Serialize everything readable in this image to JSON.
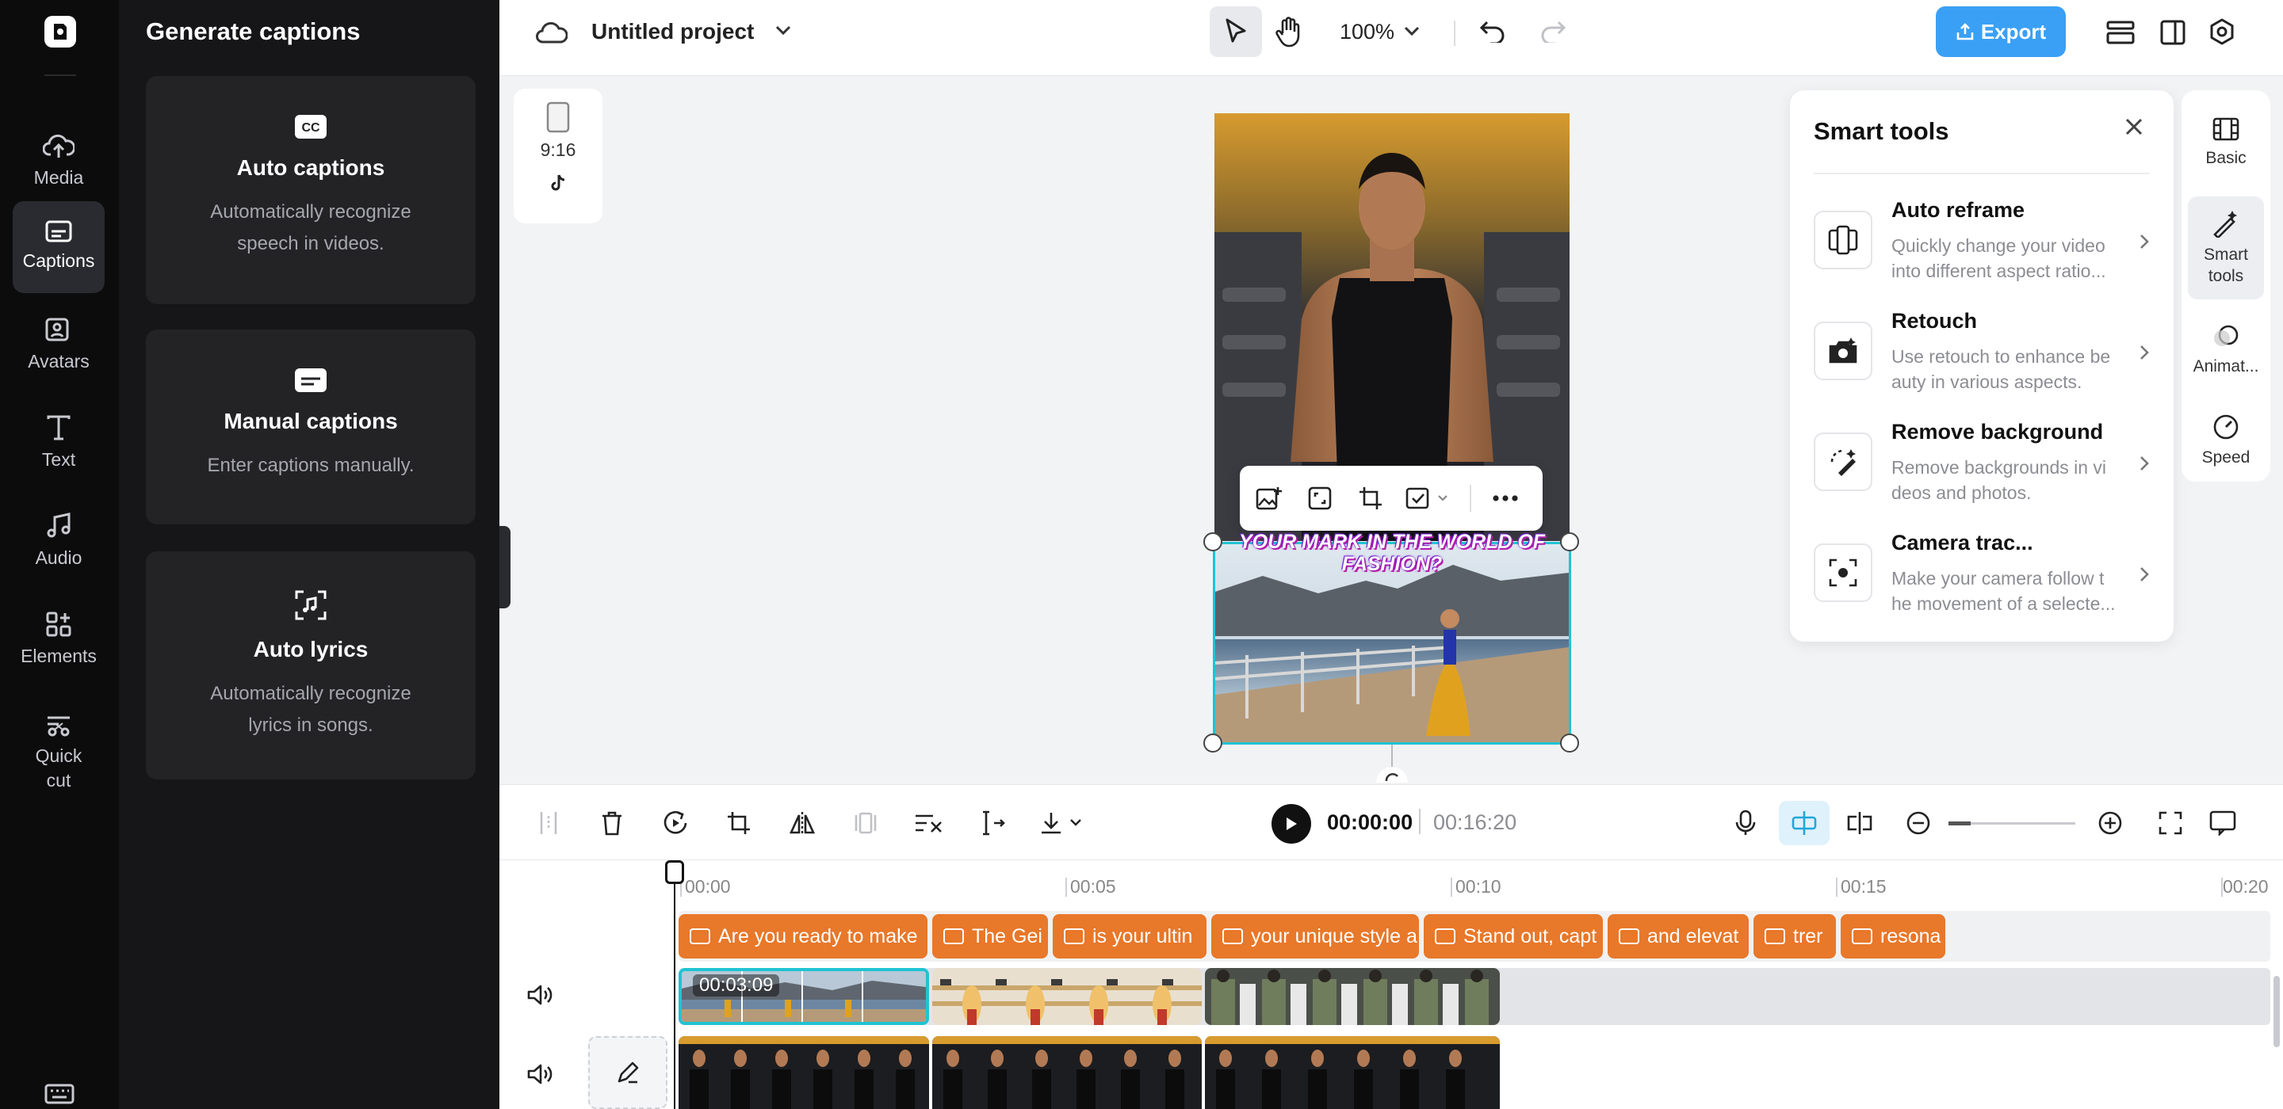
{
  "rail": {
    "items": [
      {
        "label": "Media",
        "icon": "cloud-upload-icon"
      },
      {
        "label": "Captions",
        "icon": "captions-icon"
      },
      {
        "label": "Avatars",
        "icon": "avatar-icon"
      },
      {
        "label": "Text",
        "icon": "text-icon"
      },
      {
        "label": "Audio",
        "icon": "music-note-icon"
      },
      {
        "label": "Elements",
        "icon": "elements-icon"
      },
      {
        "label": "Quick cut",
        "icon": "quick-cut-icon"
      }
    ]
  },
  "panel": {
    "title": "Generate captions",
    "cards": [
      {
        "title": "Auto captions",
        "desc": "Automatically recognize speech in videos."
      },
      {
        "title": "Manual captions",
        "desc": "Enter captions manually."
      },
      {
        "title": "Auto lyrics",
        "desc": "Automatically recognize lyrics in songs."
      }
    ]
  },
  "topbar": {
    "project": "Untitled project",
    "zoom": "100%",
    "export": "Export"
  },
  "canvas": {
    "ratio": "9:16",
    "overlay_text": "YOUR MARK IN THE WORLD OF FASHION?"
  },
  "smart_tools": {
    "title": "Smart tools",
    "items": [
      {
        "name": "Auto reframe",
        "desc": "Quickly change your video into different aspect ratio..."
      },
      {
        "name": "Retouch",
        "desc": "Use retouch to enhance be auty in various aspects."
      },
      {
        "name": "Remove background",
        "desc": "Remove backgrounds in vi deos and photos."
      },
      {
        "name": "Camera trac...",
        "desc": "Make your camera follow t he movement of a selecte..."
      }
    ]
  },
  "right_rail": {
    "items": [
      {
        "label": "Basic"
      },
      {
        "label": "Smart tools"
      },
      {
        "label": "Animat..."
      },
      {
        "label": "Speed"
      }
    ]
  },
  "player": {
    "current": "00:00:00",
    "total": "00:16:20"
  },
  "timeline": {
    "ruler": [
      "00:00",
      "00:05",
      "00:10",
      "00:15",
      "00:20"
    ],
    "captions": [
      "Are you ready to make",
      "The Gei",
      "is your ultin",
      "your unique style a",
      "Stand out, capt",
      "and elevat",
      "trer",
      "resona"
    ],
    "selected_clip_time": "00:03:09"
  },
  "colors": {
    "accent": "#3aa0f5",
    "selection": "#20c3d2",
    "caption_clip": "#e8782a"
  }
}
